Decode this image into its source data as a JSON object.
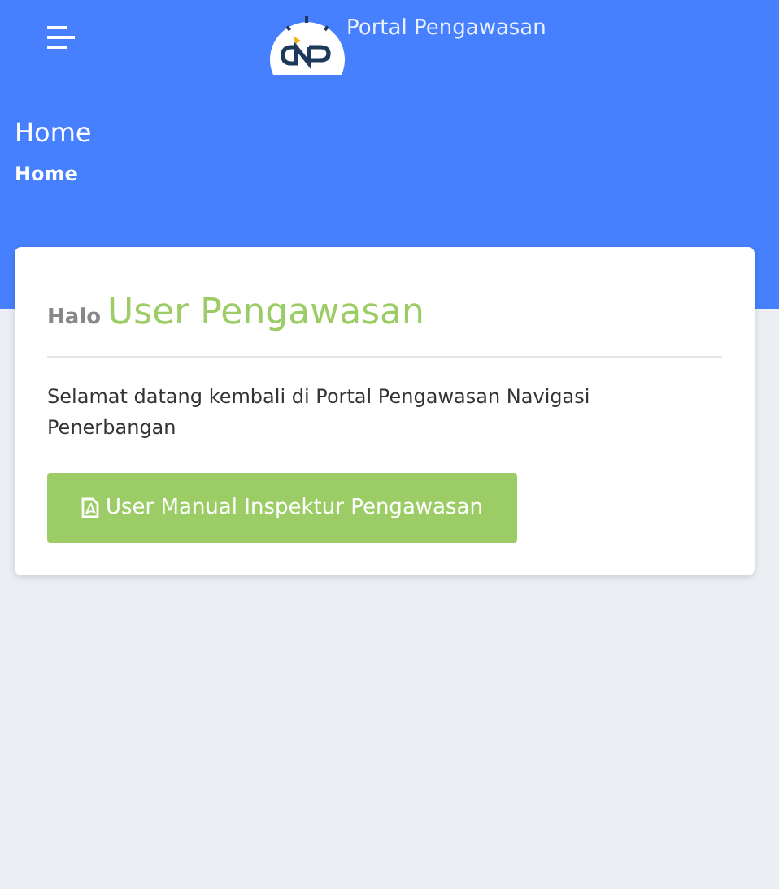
{
  "navbar": {
    "title": "Portal Pengawasan"
  },
  "page_header": {
    "title": "Home",
    "breadcrumb": "Home"
  },
  "card": {
    "greeting": "Halo",
    "user_name": "User Pengawasan",
    "message": "Selamat datang kembali di Portal Pengawasan Navigasi Penerbangan",
    "button": "User Manual Inspektur Pengawasan"
  }
}
